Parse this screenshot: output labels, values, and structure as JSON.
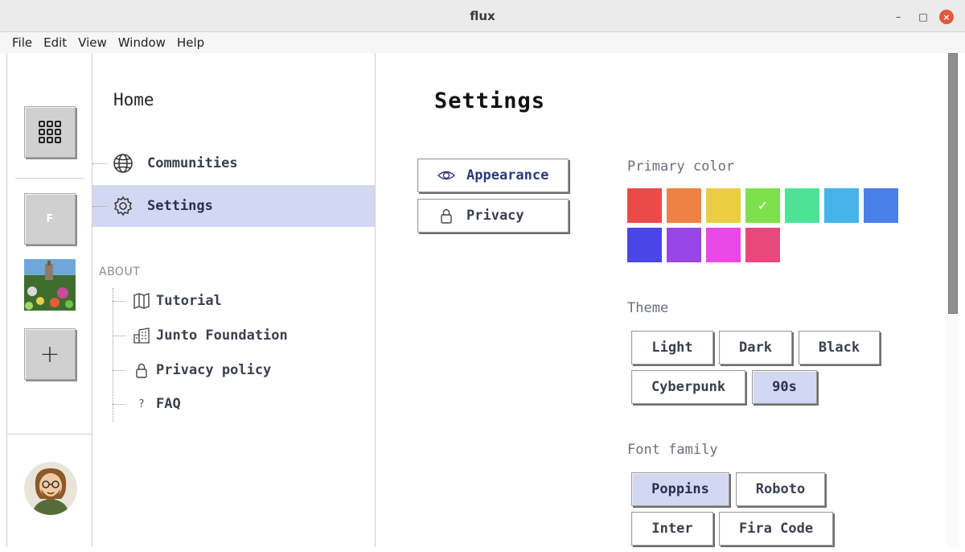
{
  "window": {
    "title": "flux",
    "minimize": "–",
    "maximize": "□",
    "close": "×"
  },
  "menubar": [
    "File",
    "Edit",
    "View",
    "Window",
    "Help"
  ],
  "rail": {
    "community_initial": "F",
    "add_label": "+"
  },
  "sidebar": {
    "home": "Home",
    "items": [
      {
        "label": "Communities",
        "icon": "globe-icon"
      },
      {
        "label": "Settings",
        "icon": "gear-icon",
        "active": true
      }
    ],
    "about_heading": "ABOUT",
    "about_items": [
      {
        "label": "Tutorial",
        "icon": "map-icon"
      },
      {
        "label": "Junto Foundation",
        "icon": "building-icon"
      },
      {
        "label": "Privacy policy",
        "icon": "lock-icon"
      },
      {
        "label": "FAQ",
        "icon": "?"
      }
    ]
  },
  "main": {
    "title": "Settings",
    "tabs": [
      {
        "label": "Appearance",
        "icon": "eye-icon",
        "active": true
      },
      {
        "label": "Privacy",
        "icon": "lock-icon"
      }
    ],
    "primary_color": {
      "label": "Primary color",
      "selected_index": 3,
      "colors": [
        "#ea4a4a",
        "#ee8145",
        "#ebcd43",
        "#7ee04c",
        "#4de397",
        "#47b3ea",
        "#4b7fe8",
        "#4946e6",
        "#9846e6",
        "#ea47e6",
        "#ea487d"
      ]
    },
    "theme": {
      "label": "Theme",
      "options": [
        "Light",
        "Dark",
        "Black",
        "Cyberpunk",
        "90s"
      ],
      "selected": "90s"
    },
    "font_family": {
      "label": "Font family",
      "options": [
        "Poppins",
        "Roboto",
        "Inter",
        "Fira Code"
      ],
      "selected": "Poppins"
    }
  }
}
